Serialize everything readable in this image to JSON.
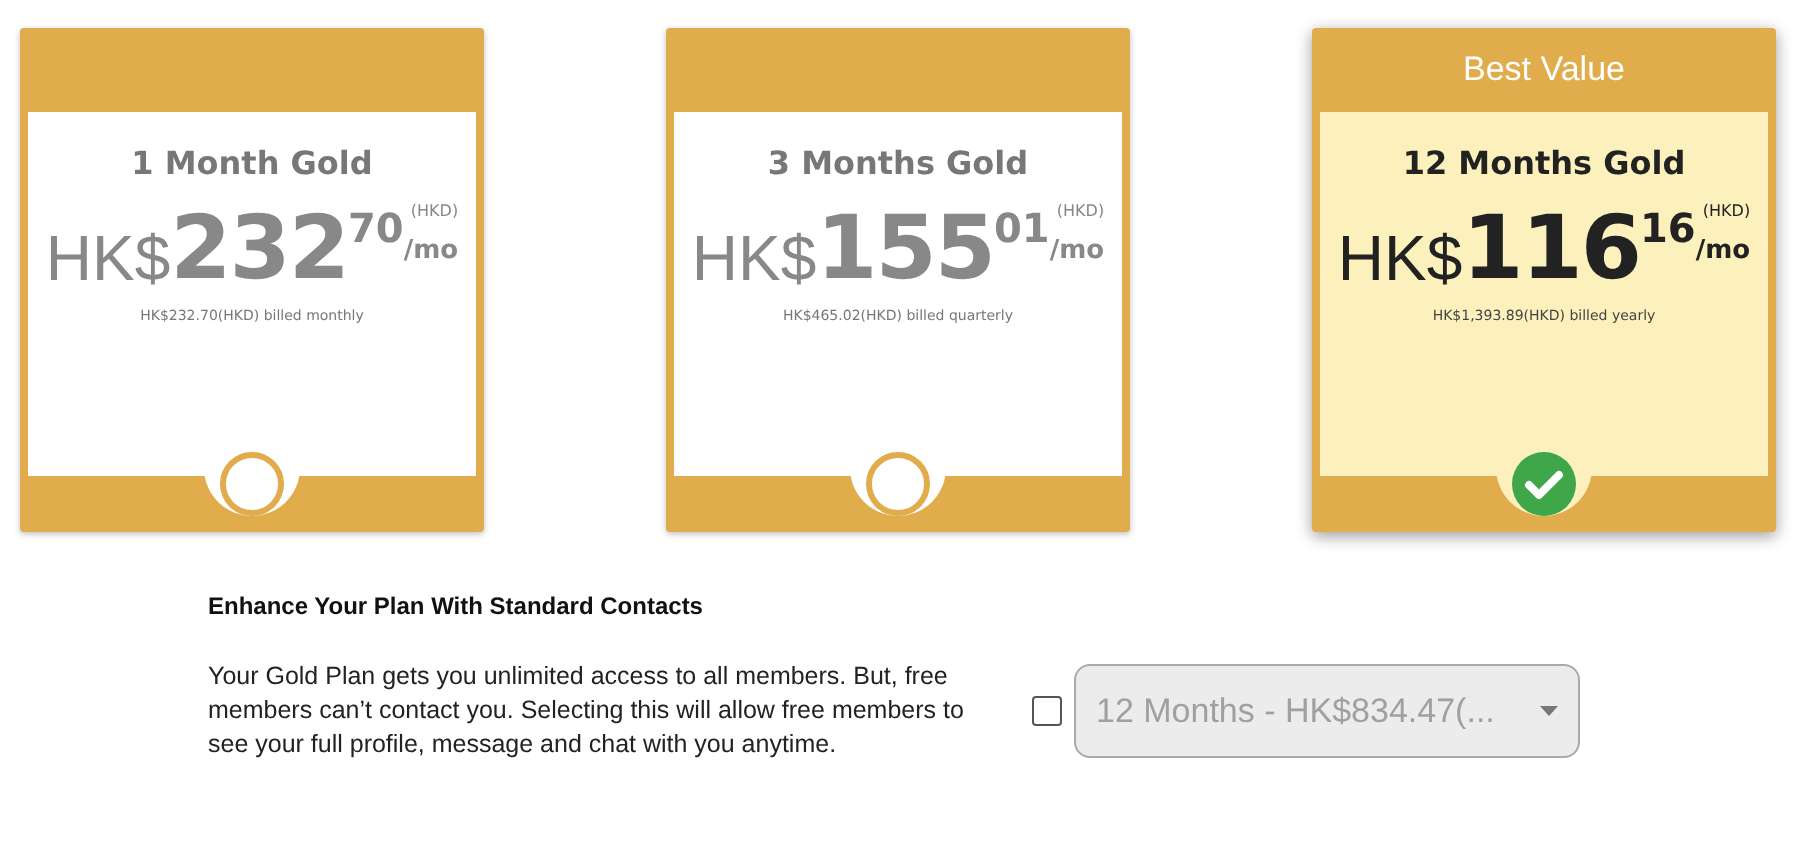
{
  "plans": [
    {
      "name": "1 Month Gold",
      "currency": "HK$",
      "whole": "232",
      "cents": "70",
      "unit": "(HKD)",
      "per": "/mo",
      "billed": "HK$232.70(HKD) billed monthly",
      "selected": false
    },
    {
      "name": "3 Months Gold",
      "currency": "HK$",
      "whole": "155",
      "cents": "01",
      "unit": "(HKD)",
      "per": "/mo",
      "billed": "HK$465.02(HKD) billed quarterly",
      "selected": false
    },
    {
      "badge": "Best Value",
      "name": "12 Months Gold",
      "currency": "HK$",
      "whole": "116",
      "cents": "16",
      "unit": "(HKD)",
      "per": "/mo",
      "billed": "HK$1,393.89(HKD) billed yearly",
      "selected": true
    }
  ],
  "addon": {
    "heading": "Enhance Your Plan With Standard Contacts",
    "description": "Your Gold Plan gets you unlimited access to all members. But, free members can’t contact you. Selecting this will allow free members to see your full profile, message and chat with you anytime.",
    "checked": false,
    "dropdown": {
      "value": "12 Months - HK$834.47(...",
      "disabled": true
    }
  }
}
